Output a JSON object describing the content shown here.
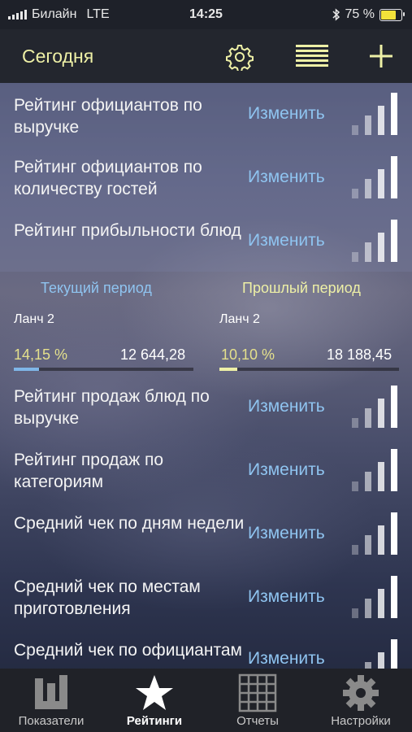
{
  "status": {
    "carrier": "Билайн",
    "network": "LTE",
    "time": "14:25",
    "battery": "75 %",
    "battery_level": 0.75
  },
  "header": {
    "title": "Сегодня",
    "settings_icon": "gear-icon",
    "list_icon": "list-icon",
    "add_icon": "plus-icon"
  },
  "ratings_top": [
    {
      "label": "Рейтинг официантов по выручке",
      "edit": "Изменить"
    },
    {
      "label": "Рейтинг официантов по количеству гостей",
      "edit": "Изменить"
    },
    {
      "label": "Рейтинг прибыльности блюд",
      "edit": "Изменить"
    }
  ],
  "period": {
    "current_label": "Текущий период",
    "previous_label": "Прошлый период",
    "current": {
      "name": "Ланч 2",
      "percent": "14,15 %",
      "sum": "12 644,28",
      "share": 0.1415
    },
    "previous": {
      "name": "Ланч 2",
      "percent": "10,10 %",
      "sum": "18 188,45",
      "share": 0.101
    }
  },
  "ratings_bottom": [
    {
      "label": "Рейтинг продаж блюд по выручке",
      "edit": "Изменить"
    },
    {
      "label": "Рейтинг продаж по категориям",
      "edit": "Изменить"
    },
    {
      "label": "Средний чек по дням недели",
      "edit": "Изменить"
    },
    {
      "label": "Средний чек по местам приготовления",
      "edit": "Изменить"
    },
    {
      "label": "Средний чек по официантам",
      "edit": "Изменить"
    }
  ],
  "tabs": [
    {
      "label": "Показатели",
      "icon": "dashboard-icon"
    },
    {
      "label": "Рейтинги",
      "icon": "star-icon"
    },
    {
      "label": "Отчеты",
      "icon": "grid-icon"
    },
    {
      "label": "Настройки",
      "icon": "gear-icon"
    }
  ],
  "colors": {
    "accent_yellow": "#eef0a6",
    "link_blue": "#8fc4f0",
    "current_bar": "#7fb6e8",
    "previous_bar": "#eef0a6"
  }
}
